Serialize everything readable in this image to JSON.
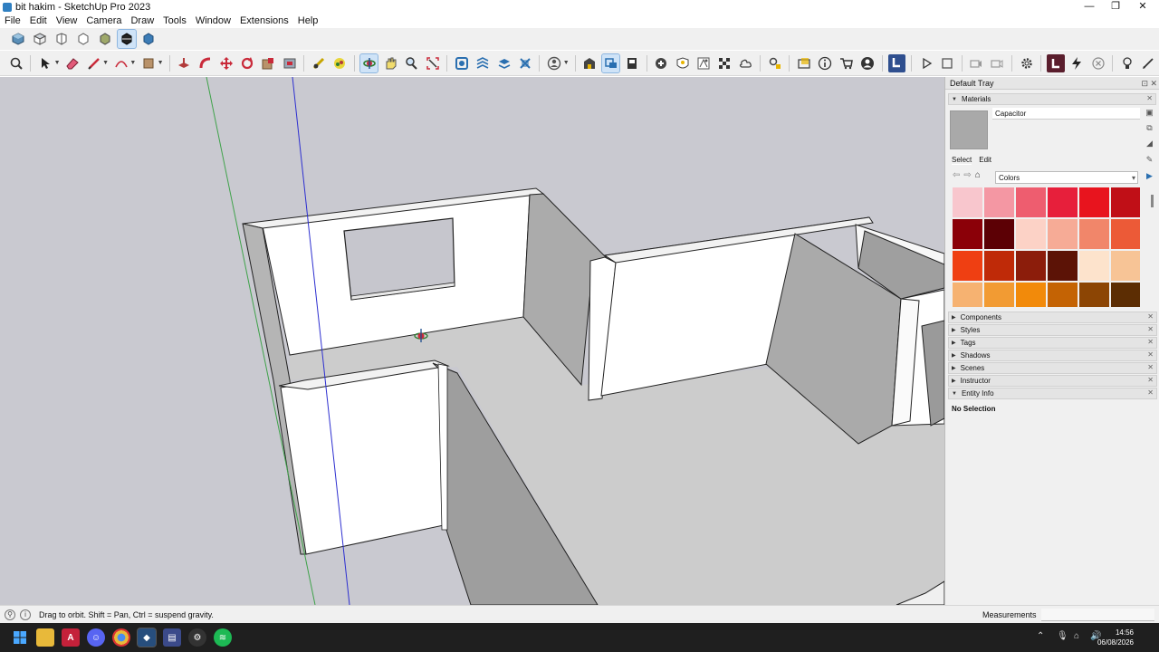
{
  "window": {
    "title": "bit hakim - SketchUp Pro 2023",
    "minimize": "—",
    "maximize": "❐",
    "close": "✕"
  },
  "menu": [
    "File",
    "Edit",
    "View",
    "Camera",
    "Draw",
    "Tools",
    "Window",
    "Extensions",
    "Help"
  ],
  "toolbar_top_icons": [
    "iso-view-icon",
    "top-view-icon",
    "front-view-icon",
    "right-view-icon",
    "back-view-icon",
    "left-view-icon",
    "bottom-view-icon"
  ],
  "toolbar_main_icons": [
    "zoom-extents-icon",
    "select-icon",
    "eraser-icon",
    "pencil-icon",
    "arc-icon",
    "rectangle-icon",
    "push-pull-icon",
    "follow-me-icon",
    "move-icon",
    "rotate-icon",
    "scale-icon",
    "offset-icon",
    "tape-measure-icon",
    "paint-bucket-icon",
    "orbit-icon",
    "pan-icon",
    "zoom-icon",
    "zoom-window-icon",
    "section-plane-icon",
    "section-display-icon",
    "section-cuts-icon",
    "section-fill-icon",
    "user-icon",
    "warehouse-icon",
    "extension-warehouse-icon",
    "layout-icon",
    "add-location-icon",
    "geo-icon",
    "texture-icon",
    "cloud-icon",
    "settings-icon",
    "folder-icon",
    "info-icon",
    "cart-icon",
    "account-icon",
    "trimble-icon",
    "play-icon",
    "stop-icon",
    "camera-icon",
    "video-icon",
    "gear-icon",
    "extension-icon",
    "lightning-icon",
    "cancel-icon",
    "bulb-icon",
    "pen-icon"
  ],
  "tray": {
    "title": "Default Tray",
    "materials_label": "Materials",
    "material_name": "Capacitor",
    "tab_select": "Select",
    "tab_edit": "Edit",
    "collection": "Colors",
    "swatches": [
      "#f8c6cd",
      "#f497a3",
      "#ee5d6f",
      "#e71f3b",
      "#e8141e",
      "#c00f17",
      "#8b0008",
      "#5c0005",
      "#fcd2c6",
      "#f6ab96",
      "#f1866a",
      "#ec5a37",
      "#ef3f12",
      "#bf2a08",
      "#8c1d0b",
      "#5c1306",
      "#fde3cc",
      "#f7c496",
      "#f6b271",
      "#f29b33",
      "#f28a0a",
      "#c46304",
      "#8c4504",
      "#5c2d03"
    ],
    "sections": [
      "Components",
      "Styles",
      "Tags",
      "Shadows",
      "Scenes",
      "Instructor",
      "Entity Info"
    ],
    "entity_info": "No Selection"
  },
  "status": {
    "text": "Drag to orbit. Shift = Pan, Ctrl = suspend gravity.",
    "measurements_label": "Measurements",
    "measurements_value": ""
  },
  "taskbar": {
    "apps": [
      "windows-start-icon",
      "file-explorer-icon",
      "app-a-icon",
      "discord-icon",
      "chrome-icon",
      "sketchup-icon",
      "layout-icon",
      "github-icon",
      "spotify-icon"
    ],
    "time": "14:56",
    "date": "06/08/2026"
  }
}
